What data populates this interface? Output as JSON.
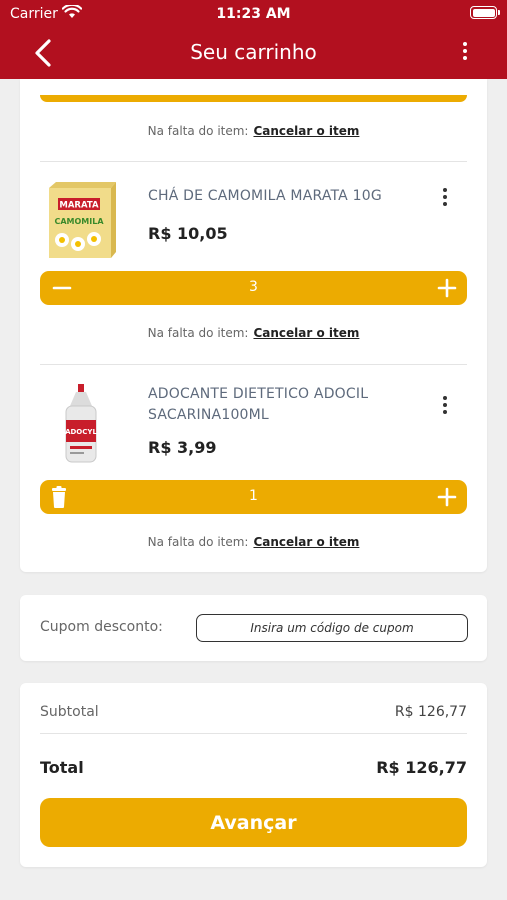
{
  "status_bar": {
    "carrier": "Carrier",
    "time": "11:23 AM"
  },
  "header": {
    "title": "Seu carrinho"
  },
  "shortage": {
    "label": "Na falta do item:",
    "cancel_label": "Cancelar o item"
  },
  "items": [
    {
      "name": "CHÁ DE CAMOMILA MARATA 10G",
      "price": "R$ 10,05",
      "quantity": "3",
      "image_icon": "chamomile-tea-box-icon"
    },
    {
      "name": "ADOCANTE DIETETICO ADOCIL SACARINA100ML",
      "price": "R$ 3,99",
      "quantity": "1",
      "image_icon": "sweetener-bottle-icon"
    }
  ],
  "coupon": {
    "label": "Cupom desconto:",
    "placeholder": "Insira um código de cupom"
  },
  "summary": {
    "subtotal_label": "Subtotal",
    "subtotal_value": "R$ 126,77",
    "total_label": "Total",
    "total_value": "R$ 126,77"
  },
  "actions": {
    "advance_label": "Avançar"
  },
  "colors": {
    "brand_red": "#b2101f",
    "accent_yellow": "#ecab01",
    "background": "#efefef"
  }
}
